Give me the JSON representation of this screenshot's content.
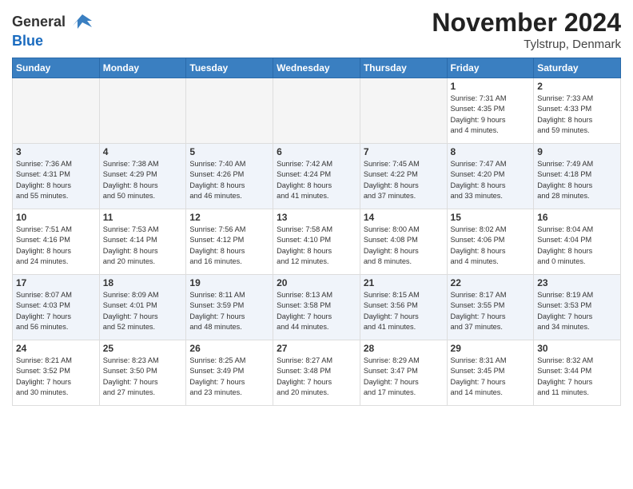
{
  "header": {
    "logo_general": "General",
    "logo_blue": "Blue",
    "month_title": "November 2024",
    "location": "Tylstrup, Denmark"
  },
  "weekdays": [
    "Sunday",
    "Monday",
    "Tuesday",
    "Wednesday",
    "Thursday",
    "Friday",
    "Saturday"
  ],
  "weeks": [
    [
      {
        "day": "",
        "info": ""
      },
      {
        "day": "",
        "info": ""
      },
      {
        "day": "",
        "info": ""
      },
      {
        "day": "",
        "info": ""
      },
      {
        "day": "",
        "info": ""
      },
      {
        "day": "1",
        "info": "Sunrise: 7:31 AM\nSunset: 4:35 PM\nDaylight: 9 hours\nand 4 minutes."
      },
      {
        "day": "2",
        "info": "Sunrise: 7:33 AM\nSunset: 4:33 PM\nDaylight: 8 hours\nand 59 minutes."
      }
    ],
    [
      {
        "day": "3",
        "info": "Sunrise: 7:36 AM\nSunset: 4:31 PM\nDaylight: 8 hours\nand 55 minutes."
      },
      {
        "day": "4",
        "info": "Sunrise: 7:38 AM\nSunset: 4:29 PM\nDaylight: 8 hours\nand 50 minutes."
      },
      {
        "day": "5",
        "info": "Sunrise: 7:40 AM\nSunset: 4:26 PM\nDaylight: 8 hours\nand 46 minutes."
      },
      {
        "day": "6",
        "info": "Sunrise: 7:42 AM\nSunset: 4:24 PM\nDaylight: 8 hours\nand 41 minutes."
      },
      {
        "day": "7",
        "info": "Sunrise: 7:45 AM\nSunset: 4:22 PM\nDaylight: 8 hours\nand 37 minutes."
      },
      {
        "day": "8",
        "info": "Sunrise: 7:47 AM\nSunset: 4:20 PM\nDaylight: 8 hours\nand 33 minutes."
      },
      {
        "day": "9",
        "info": "Sunrise: 7:49 AM\nSunset: 4:18 PM\nDaylight: 8 hours\nand 28 minutes."
      }
    ],
    [
      {
        "day": "10",
        "info": "Sunrise: 7:51 AM\nSunset: 4:16 PM\nDaylight: 8 hours\nand 24 minutes."
      },
      {
        "day": "11",
        "info": "Sunrise: 7:53 AM\nSunset: 4:14 PM\nDaylight: 8 hours\nand 20 minutes."
      },
      {
        "day": "12",
        "info": "Sunrise: 7:56 AM\nSunset: 4:12 PM\nDaylight: 8 hours\nand 16 minutes."
      },
      {
        "day": "13",
        "info": "Sunrise: 7:58 AM\nSunset: 4:10 PM\nDaylight: 8 hours\nand 12 minutes."
      },
      {
        "day": "14",
        "info": "Sunrise: 8:00 AM\nSunset: 4:08 PM\nDaylight: 8 hours\nand 8 minutes."
      },
      {
        "day": "15",
        "info": "Sunrise: 8:02 AM\nSunset: 4:06 PM\nDaylight: 8 hours\nand 4 minutes."
      },
      {
        "day": "16",
        "info": "Sunrise: 8:04 AM\nSunset: 4:04 PM\nDaylight: 8 hours\nand 0 minutes."
      }
    ],
    [
      {
        "day": "17",
        "info": "Sunrise: 8:07 AM\nSunset: 4:03 PM\nDaylight: 7 hours\nand 56 minutes."
      },
      {
        "day": "18",
        "info": "Sunrise: 8:09 AM\nSunset: 4:01 PM\nDaylight: 7 hours\nand 52 minutes."
      },
      {
        "day": "19",
        "info": "Sunrise: 8:11 AM\nSunset: 3:59 PM\nDaylight: 7 hours\nand 48 minutes."
      },
      {
        "day": "20",
        "info": "Sunrise: 8:13 AM\nSunset: 3:58 PM\nDaylight: 7 hours\nand 44 minutes."
      },
      {
        "day": "21",
        "info": "Sunrise: 8:15 AM\nSunset: 3:56 PM\nDaylight: 7 hours\nand 41 minutes."
      },
      {
        "day": "22",
        "info": "Sunrise: 8:17 AM\nSunset: 3:55 PM\nDaylight: 7 hours\nand 37 minutes."
      },
      {
        "day": "23",
        "info": "Sunrise: 8:19 AM\nSunset: 3:53 PM\nDaylight: 7 hours\nand 34 minutes."
      }
    ],
    [
      {
        "day": "24",
        "info": "Sunrise: 8:21 AM\nSunset: 3:52 PM\nDaylight: 7 hours\nand 30 minutes."
      },
      {
        "day": "25",
        "info": "Sunrise: 8:23 AM\nSunset: 3:50 PM\nDaylight: 7 hours\nand 27 minutes."
      },
      {
        "day": "26",
        "info": "Sunrise: 8:25 AM\nSunset: 3:49 PM\nDaylight: 7 hours\nand 23 minutes."
      },
      {
        "day": "27",
        "info": "Sunrise: 8:27 AM\nSunset: 3:48 PM\nDaylight: 7 hours\nand 20 minutes."
      },
      {
        "day": "28",
        "info": "Sunrise: 8:29 AM\nSunset: 3:47 PM\nDaylight: 7 hours\nand 17 minutes."
      },
      {
        "day": "29",
        "info": "Sunrise: 8:31 AM\nSunset: 3:45 PM\nDaylight: 7 hours\nand 14 minutes."
      },
      {
        "day": "30",
        "info": "Sunrise: 8:32 AM\nSunset: 3:44 PM\nDaylight: 7 hours\nand 11 minutes."
      }
    ]
  ]
}
